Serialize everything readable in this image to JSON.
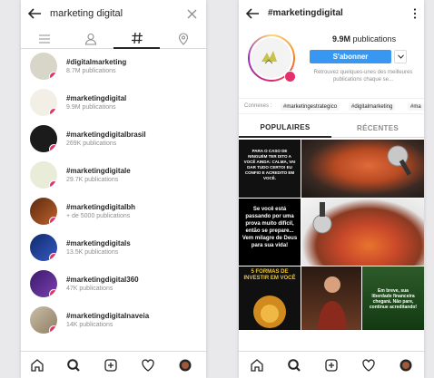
{
  "left": {
    "search_query": "marketing digital",
    "results": [
      {
        "tag": "#digitalmarketing",
        "count": "8.7M publications"
      },
      {
        "tag": "#marketingdigital",
        "count": "9.9M publications"
      },
      {
        "tag": "#marketingdigitalbrasil",
        "count": "269K publications"
      },
      {
        "tag": "#marketingdigitale",
        "count": "29.7K publications"
      },
      {
        "tag": "#marketingdigitalbh",
        "count": "+ de 5000 publications"
      },
      {
        "tag": "#marketingdigitals",
        "count": "13.5K publications"
      },
      {
        "tag": "#marketingdigital360",
        "count": "47K publications"
      },
      {
        "tag": "#marketingdigitalnaveia",
        "count": "14K publications"
      }
    ]
  },
  "right": {
    "title": "#marketingdigital",
    "pub_number": "9.9M",
    "pub_label": "publications",
    "follow_label": "S'abonner",
    "recent_note": "Retrouvez quelques-unes des meilleures publications chaque se...",
    "related_label": "Connexes :",
    "related_tags": [
      "#marketingestrategico",
      "#digitalmarketing",
      "#ma"
    ],
    "tab_top": "POPULAIRES",
    "tab_recent": "RÉCENTES",
    "posts": {
      "p1": "PARA O CASO DE NINGUÉM TER DITO A VOCÊ AINDA: CALMA, VAI DAR TUDO CERTO! EU CONFIO E ACREDITO EM VOCÊ.",
      "p3": "Se você está passando por uma prova muito difícil, então se prepare... Vem milagre de Deus para sua vida!",
      "p5": "5 FORMAS DE INVESTIR EM VOCÊ",
      "p7": "Em breve, sua liberdade financeira chegará. Não pare, continue acreditando!"
    }
  },
  "colors": {
    "accent": "#3897f0",
    "badge": "#e1306c"
  }
}
